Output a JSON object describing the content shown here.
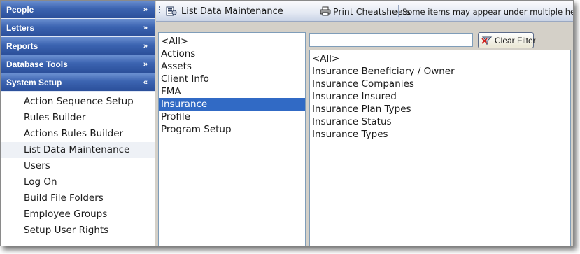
{
  "sidebar": {
    "sections": [
      {
        "label": "People",
        "chevron": "chevron-double-down",
        "expanded": false
      },
      {
        "label": "Letters",
        "chevron": "chevron-double-down",
        "expanded": false
      },
      {
        "label": "Reports",
        "chevron": "chevron-double-down",
        "expanded": false
      },
      {
        "label": "Database Tools",
        "chevron": "chevron-double-down",
        "expanded": false
      },
      {
        "label": "System Setup",
        "chevron": "chevron-double-up",
        "expanded": true
      }
    ],
    "system_setup_items": [
      "Action Sequence Setup",
      "Rules Builder",
      "Actions Rules Builder",
      "List Data Maintenance",
      "Users",
      "Log On",
      "Build File Folders",
      "Employee Groups",
      "Setup User Rights"
    ],
    "active_item": "List Data Maintenance"
  },
  "toolbar": {
    "title": "List Data Maintenance",
    "title_icon": "list-data-icon",
    "print_label": "Print Cheatsheets",
    "print_icon": "printer-icon",
    "note": "Some items may appear under multiple headings."
  },
  "categories": {
    "items": [
      "<All>",
      "Actions",
      "Assets",
      "Client Info",
      "FMA",
      "Insurance",
      "Profile",
      "Program Setup"
    ],
    "selected": "Insurance"
  },
  "filter": {
    "value": "",
    "clear_label": "Clear Filter",
    "clear_icon": "clear-filter-icon"
  },
  "list_items": [
    "<All>",
    "Insurance Beneficiary / Owner",
    "Insurance Companies",
    "Insurance Insured",
    "Insurance Plan Types",
    "Insurance Status",
    "Insurance Types"
  ],
  "colors": {
    "header_blue": "#3c64b1",
    "selection_blue": "#316ac5",
    "chrome_gray": "#d4d0c8"
  }
}
